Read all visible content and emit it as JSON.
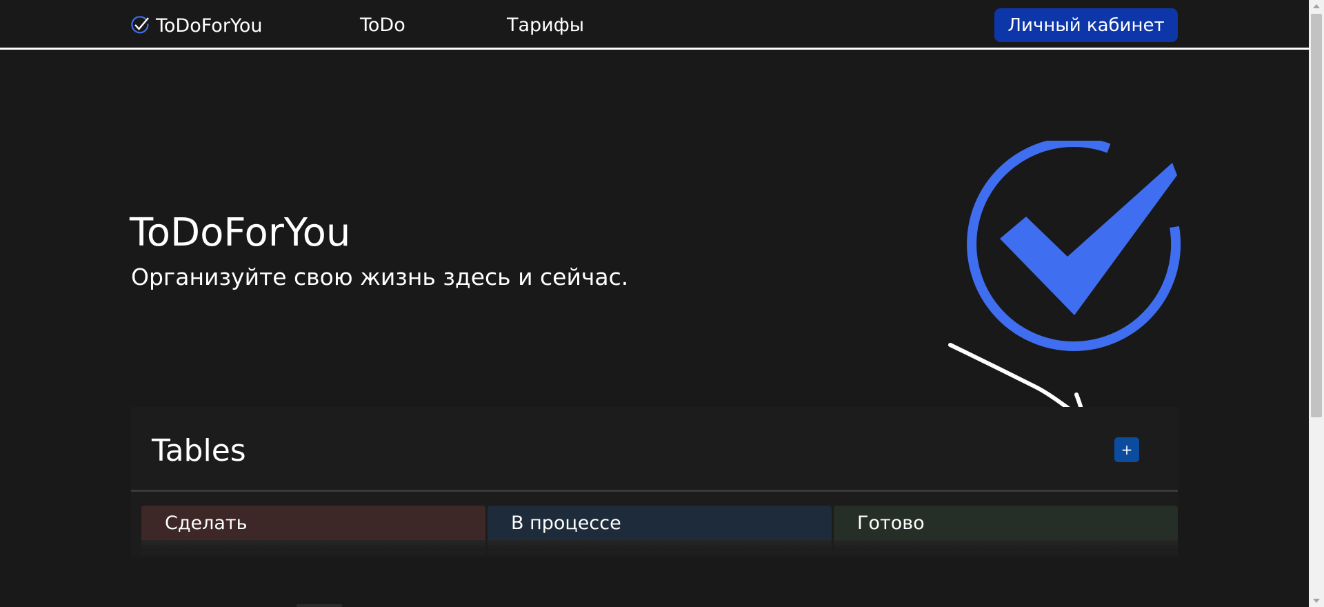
{
  "navbar": {
    "brand": "ToDoForYou",
    "links": [
      "ToDo",
      "Тарифы"
    ],
    "cabinet_button": "Личный кабинет"
  },
  "hero": {
    "title": "ToDoForYou",
    "subtitle": "Организуйте свою жизнь здесь и сейчас."
  },
  "tables": {
    "title": "Tables",
    "add_button": "+",
    "columns": [
      "Сделать",
      "В процессе",
      "Готово"
    ]
  },
  "colors": {
    "background": "#1a1919",
    "accent": "#3f6ef0",
    "button": "#0d37a8",
    "col_todo": "#3e2727",
    "col_progress": "#1d2b3a",
    "col_done": "#252f28"
  },
  "icons": {
    "brand": "check-circle-icon",
    "hero": "check-circle-icon",
    "annotation": "hand-drawn-arrow-circle"
  }
}
